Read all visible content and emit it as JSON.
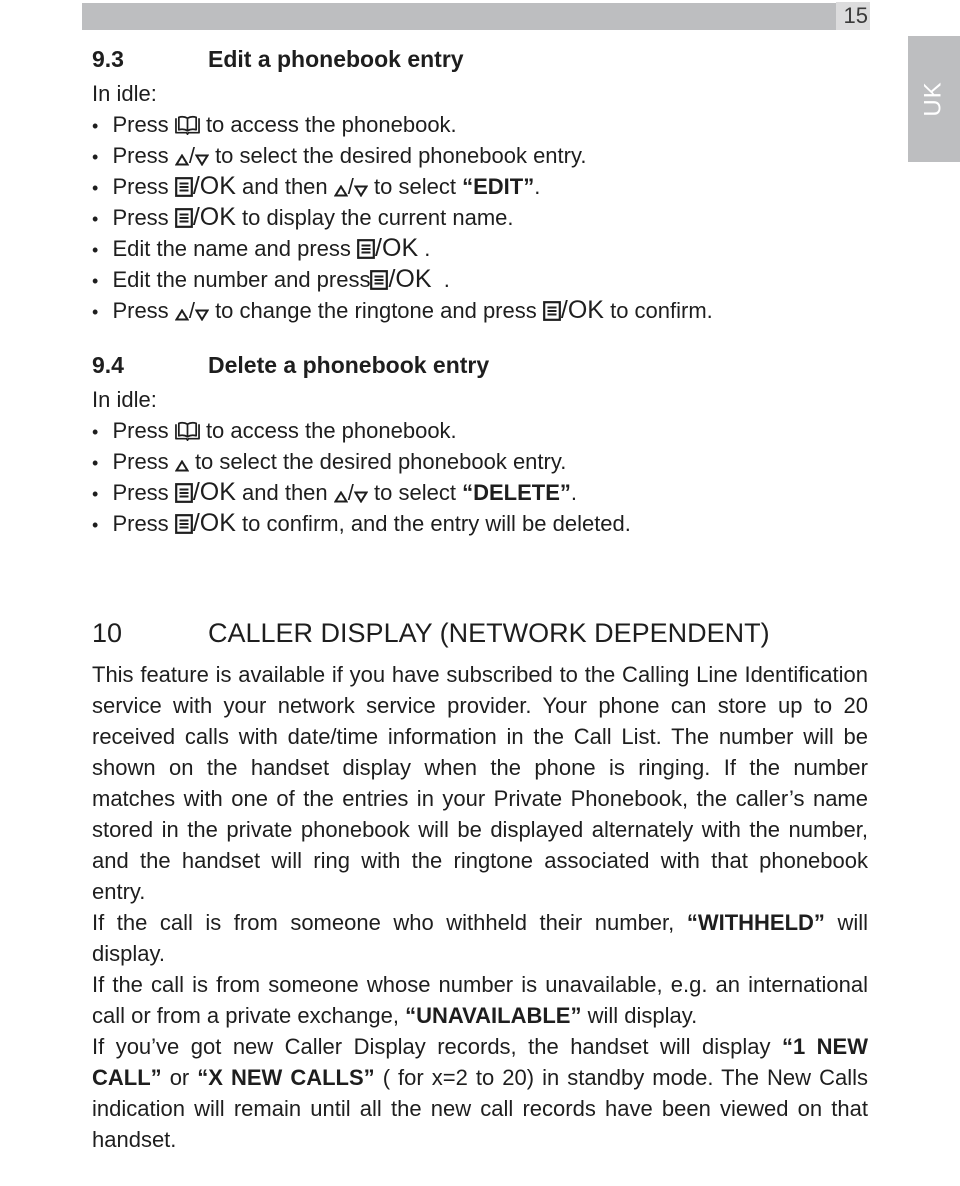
{
  "page": {
    "number": "15",
    "language_tab": "UK"
  },
  "section_9_3": {
    "number": "9.3",
    "title": "Edit a phonebook entry",
    "intro": "In idle:",
    "steps": {
      "s1": {
        "a": "Press",
        "b": "to access the phonebook."
      },
      "s2": {
        "a": "Press",
        "sep": "/",
        "b": "to select the desired phonebook entry."
      },
      "s3": {
        "a": "Press",
        "ok": "/OK",
        "b": "and then",
        "sep": "/",
        "c": "to select",
        "quote_open": "“",
        "keyword": "EDIT",
        "quote_close": "”",
        "d": "."
      },
      "s4": {
        "a": "Press",
        "ok": "/OK",
        "b": "to display the current name."
      },
      "s5": {
        "a": "Edit the name and press",
        "ok": "/OK",
        "b": "."
      },
      "s6": {
        "a": "Edit the number and press",
        "ok": "/OK",
        "b": "."
      },
      "s7": {
        "a": "Press",
        "sep": "/",
        "b": "to change the ringtone and press",
        "ok": "/OK",
        "c": "to confirm."
      }
    }
  },
  "section_9_4": {
    "number": "9.4",
    "title": "Delete a phonebook entry",
    "intro": "In idle:",
    "steps": {
      "s1": {
        "a": "Press",
        "b": "to access the phonebook."
      },
      "s2": {
        "a": "Press",
        "b": "to select the desired phonebook entry."
      },
      "s3": {
        "a": "Press",
        "ok": "/OK",
        "b": "and then",
        "sep": "/",
        "c": "to select",
        "quote_open": "“",
        "keyword": "DELETE",
        "quote_close": "”",
        "d": "."
      },
      "s4": {
        "a": "Press",
        "ok": "/OK",
        "b": "to confirm, and the entry will be deleted."
      }
    }
  },
  "chapter_10": {
    "number": "10",
    "title": "CALLER DISPLAY (NETWORK DEPENDENT)",
    "p1": "This feature is available if you have subscribed to the Calling Line Identification service with your network service provider. Your phone can store up to 20 received calls with date/time information in the Call List. The number will be shown on the handset display when the phone is ringing. If the number matches with one of the entries in your Private Phonebook, the caller’s name stored in the private phonebook will be displayed alternately with the number, and the handset will ring with the ringtone associated with that phonebook entry.",
    "p2": {
      "a": "If the call is from someone who withheld their number,",
      "keyword": "“WITHHELD”",
      "b": "will display."
    },
    "p3": {
      "a": "If the call is from someone whose number is unavailable, e.g. an international call or from a private exchange,",
      "keyword": "“UNAVAILABLE”",
      "b": "will display."
    },
    "p4": {
      "a": "If you’ve got new Caller Display records, the handset will display",
      "k1": "“1 NEW CALL”",
      "b": "or",
      "k2": "“X NEW CALLS”",
      "c": "( for x=2 to 20) in standby mode."
    },
    "p5": "The New Calls indication will remain until all the new call records have been viewed on that handset."
  },
  "icons": {
    "phonebook": "open-book-icon",
    "up": "up-triangle-icon",
    "down": "down-triangle-icon",
    "menu_ok": "menu-ok-icon"
  }
}
